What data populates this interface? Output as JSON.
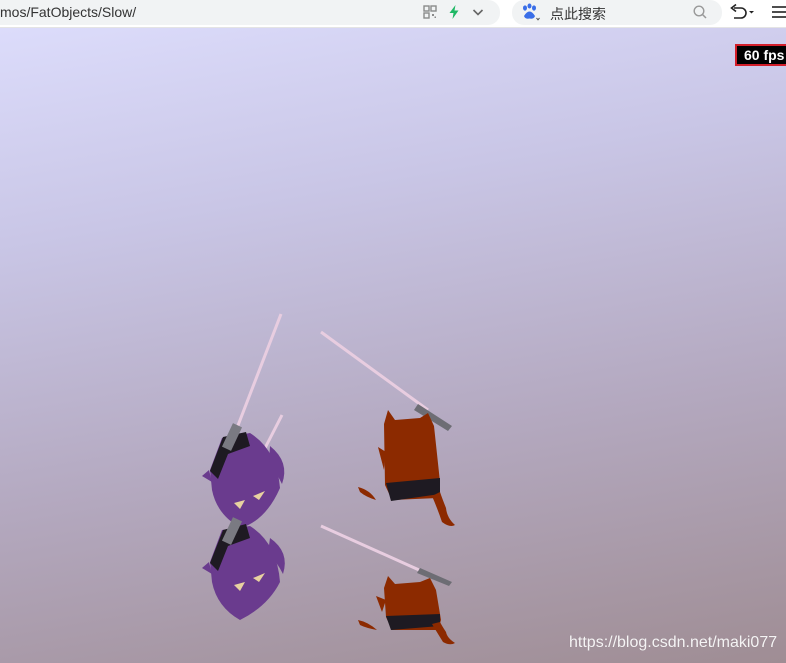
{
  "browser": {
    "url": "mos/FatObjects/Slow/",
    "search": {
      "placeholder": "点此搜索"
    }
  },
  "scene": {
    "fps_label": "60 fps",
    "watermark": "https://blog.csdn.net/maki077",
    "colors": {
      "purple_creature": "#6a3b8e",
      "orange_creature": "#8c2a00",
      "saber_beam": "#e8cde0",
      "fps_border": "#d21e2a"
    }
  }
}
